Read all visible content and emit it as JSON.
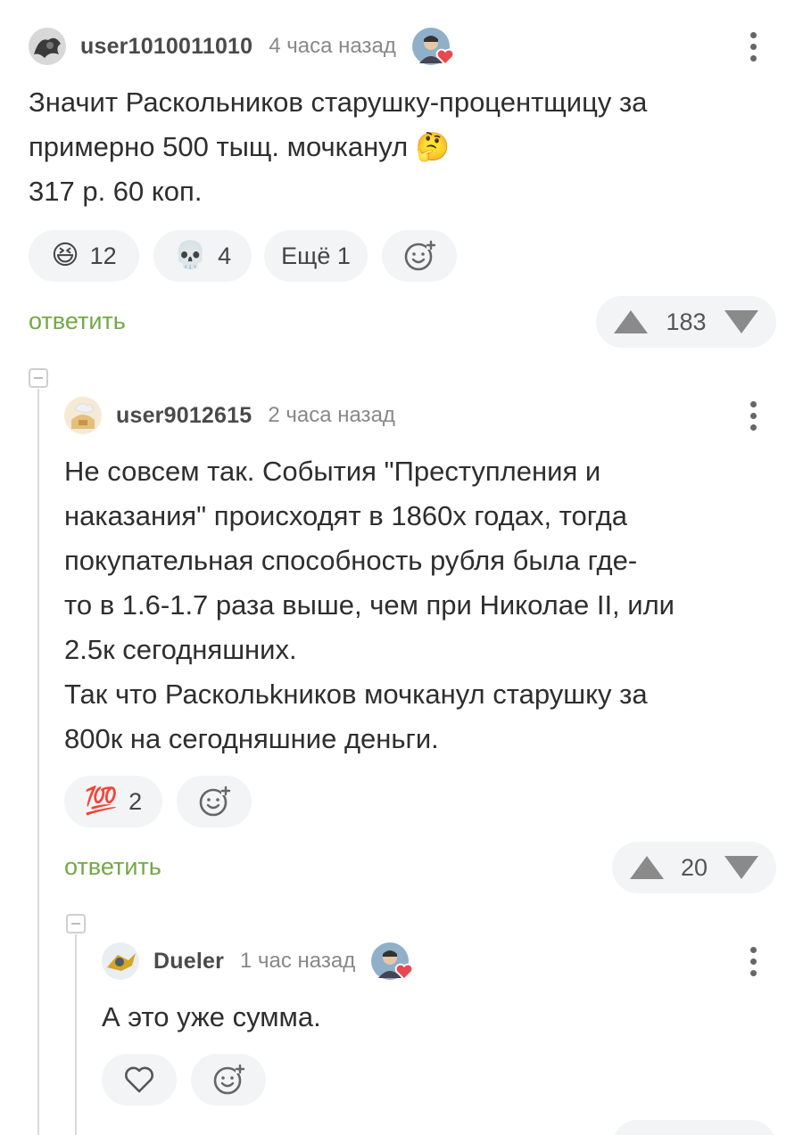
{
  "comments": [
    {
      "username": "user1010011010",
      "time": "4 часа назад",
      "text": [
        "Значит Раскольников старушку-процентщицу за",
        "примерно 500 тыщ. мочканул 🤔",
        "317 р. 60 коп."
      ],
      "reactions": [
        {
          "emoji": "😆",
          "count": "12"
        },
        {
          "emoji": "💀",
          "count": "4"
        }
      ],
      "more_reactions": "Ещё 1",
      "reply_label": "ответить",
      "rating": "183"
    },
    {
      "username": "user9012615",
      "time": "2 часа назад",
      "text": [
        "Не совсем так. События \"Преступления и",
        "наказания\" происходят в 1860х годах, тогда",
        "покупательная способность рубля была где-",
        "то в 1.6-1.7 раза выше, чем при Николае II, или",
        "2.5к сегодняшних.",
        "Так что Раскольkников мочканул старушку за",
        "800к на сегодняшние деньги."
      ],
      "reactions": [
        {
          "emoji": "💯",
          "count": "2"
        }
      ],
      "reply_label": "ответить",
      "rating": "20"
    },
    {
      "username": "Dueler",
      "time": "1 час назад",
      "text": [
        "А это уже сумма."
      ]
    }
  ],
  "colors": {
    "reply_green": "#74a847",
    "pill_bg": "#f3f4f6",
    "badge_heart": "#e8484f"
  },
  "icons": {
    "more": "vertical-dots-icon",
    "add_reaction": "smiley-plus-icon",
    "like": "heart-outline-icon",
    "upvote": "triangle-up-icon",
    "downvote": "triangle-down-icon",
    "collapse": "minus-box-icon",
    "badge": "heart-badge-icon"
  }
}
